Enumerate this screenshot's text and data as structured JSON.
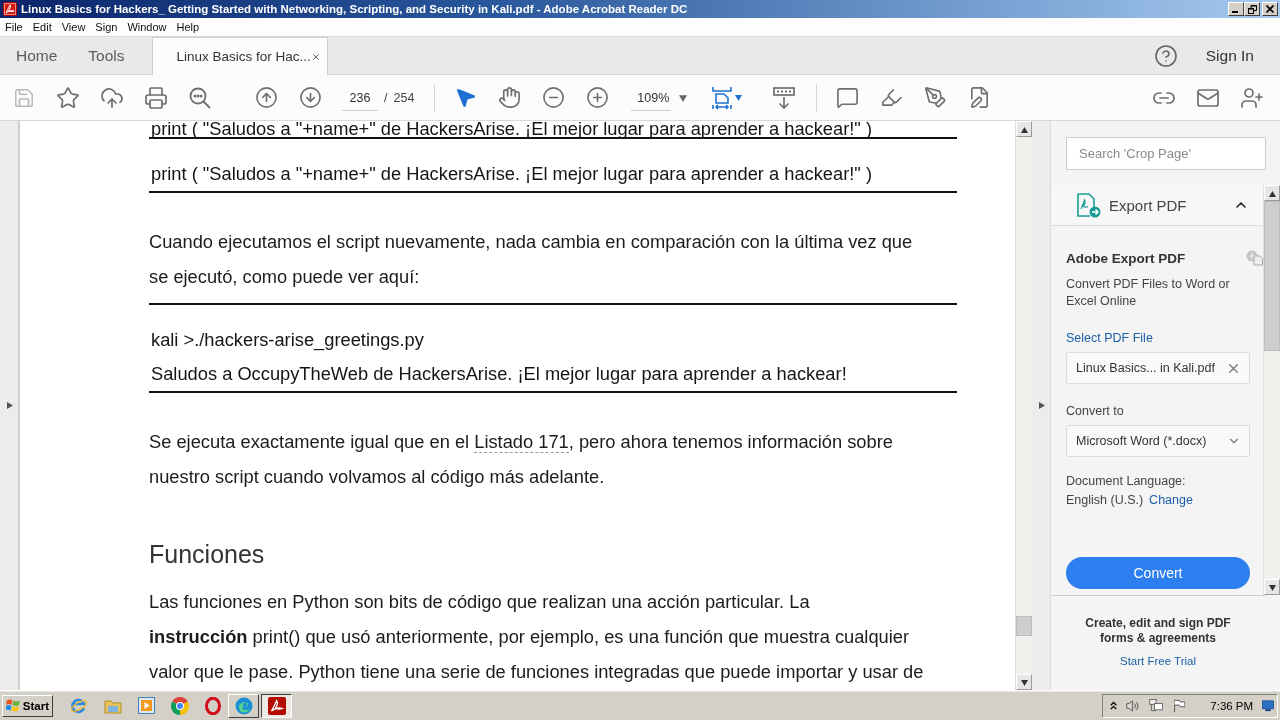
{
  "window": {
    "title": "Linux Basics for Hackers_ Getting Started with Networking, Scripting, and Security in Kali.pdf - Adobe Acrobat Reader DC"
  },
  "menu": [
    "File",
    "Edit",
    "View",
    "Sign",
    "Window",
    "Help"
  ],
  "tabs": [
    {
      "label": "Home",
      "kind": "nav",
      "selected": false
    },
    {
      "label": "Tools",
      "kind": "nav",
      "selected": false
    },
    {
      "label": "Linux Basics for Hac...",
      "kind": "document",
      "selected": true
    }
  ],
  "account": {
    "sign_in": "Sign In"
  },
  "toolbar": {
    "save": {
      "disabled": true
    },
    "page": {
      "current": "236",
      "separator": "/",
      "total": "254"
    },
    "tools": [
      {
        "selected": true
      },
      {
        "selected": false
      }
    ],
    "zoom": "109%"
  },
  "document": {
    "blocks": [
      {
        "kind": "code",
        "lines": [
          "print ( \"Saludos a \"+name+\" de HackersArise. ¡El mejor lugar para aprender a hackear!\" )"
        ]
      },
      {
        "kind": "rule"
      },
      {
        "kind": "code",
        "lines": [
          "print ( \"Saludos a \"+name+\" de HackersArise. ¡El mejor lugar para aprender a hackear!\" )"
        ]
      },
      {
        "kind": "rule"
      },
      {
        "kind": "paragraph",
        "lines": [
          [
            {
              "kind": "text",
              "text": "Cuando ejecutamos el script nuevamente, nada cambia en comparación con la última vez que"
            }
          ],
          [
            {
              "kind": "text",
              "text": "se ejecutó, como puede ver aquí:"
            }
          ]
        ]
      },
      {
        "kind": "rule"
      },
      {
        "kind": "code",
        "lines": [
          "kali >./hackers-arise_greetings.py",
          "Saludos a OccupyTheWeb de HackersArise. ¡El mejor lugar para aprender a hackear!"
        ]
      },
      {
        "kind": "rule"
      },
      {
        "kind": "paragraph",
        "lines": [
          [
            {
              "kind": "text",
              "text": "Se ejecuta exactamente igual que en el "
            },
            {
              "kind": "link",
              "text": "Listado 171"
            },
            {
              "kind": "text",
              "text": ", pero ahora tenemos información sobre"
            }
          ],
          [
            {
              "kind": "text",
              "text": "nuestro script cuando volvamos al código más adelante."
            }
          ]
        ]
      },
      {
        "kind": "heading",
        "text": "Funciones"
      },
      {
        "kind": "paragraph",
        "lines": [
          [
            {
              "kind": "text",
              "text": "Las funciones en Python son bits de código que realizan una acción particular. La"
            }
          ],
          [
            {
              "kind": "text",
              "text": "**instrucción** print() que usó anteriormente, por ejemplo, es una función que muestra cualquier"
            }
          ],
          [
            {
              "kind": "text",
              "text": "valor que le pase. Python tiene una serie de funciones integradas que puede importar y usar de"
            }
          ]
        ]
      }
    ]
  },
  "right_pane": {
    "search": {
      "placeholder": "Search 'Crop Page'"
    },
    "tool": {
      "title": "Export PDF",
      "expanded": true
    },
    "export": {
      "heading": "Adobe Export PDF",
      "description": "Convert PDF Files to Word or Excel Online",
      "select_label": "Select PDF File",
      "file": "Linux Basics... in Kali.pdf",
      "convert_label": "Convert to",
      "format": "Microsoft Word (*.docx)",
      "language_label": "Document Language:",
      "language": "English (U.S.)",
      "change": "Change",
      "button": "Convert"
    },
    "promo": {
      "text": "Create, edit and sign PDF forms & agreements",
      "link": "Start Free Trial"
    }
  },
  "taskbar": {
    "start": "Start",
    "apps": [
      {
        "selected": false
      },
      {
        "selected": true
      }
    ],
    "clock": "7:36 PM"
  }
}
